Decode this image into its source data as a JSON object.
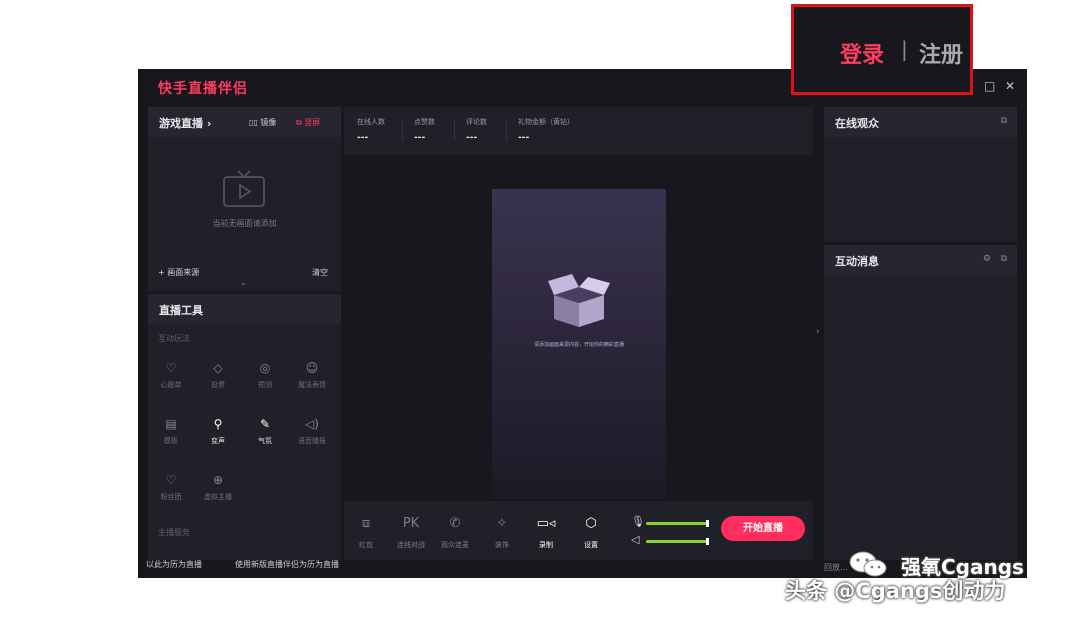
{
  "app": {
    "title": "快手直播伴侣",
    "window_controls": {
      "maximize": "□",
      "close": "✕"
    }
  },
  "auth": {
    "login": "登录",
    "separator": "|",
    "register": "注册"
  },
  "scene_panel": {
    "title": "游戏直播 ›",
    "mirror": "镜像",
    "portrait": "竖屏",
    "empty_hint": "当前无画面请添加",
    "add_source": "+ 画面来源",
    "clear": "清空"
  },
  "tools_panel": {
    "title": "直播工具",
    "section_interactive": "互动玩法",
    "tools": [
      {
        "icon": "wish-list-icon",
        "glyph": "♡",
        "label": "心愿单",
        "active": false
      },
      {
        "icon": "vote-icon",
        "glyph": "◇",
        "label": "投票",
        "active": false
      },
      {
        "icon": "predict-icon",
        "glyph": "◎",
        "label": "预测",
        "active": false
      },
      {
        "icon": "magic-face-icon",
        "glyph": "☺",
        "label": "魔法表情",
        "active": false
      },
      {
        "icon": "template-icon",
        "glyph": "▤",
        "label": "模板",
        "active": false
      },
      {
        "icon": "voice-change-icon",
        "glyph": "⚲",
        "label": "变声",
        "active": true
      },
      {
        "icon": "atmosphere-icon",
        "glyph": "✎",
        "label": "气氛",
        "active": true
      },
      {
        "icon": "voice-broadcast-icon",
        "glyph": "◁)",
        "label": "语音播报",
        "active": false
      },
      {
        "icon": "fan-group-icon",
        "glyph": "♡",
        "label": "粉丝团",
        "active": false
      },
      {
        "icon": "virtual-host-icon",
        "glyph": "⊕",
        "label": "虚拟主播",
        "active": false
      }
    ],
    "section_host": "主播服务",
    "footer_left": "以此为历为直播",
    "footer_right": "使用新版直播伴侣为历为直播"
  },
  "stats": [
    {
      "label": "在线人数",
      "value": "---"
    },
    {
      "label": "点赞数",
      "value": "---"
    },
    {
      "label": "评论数",
      "value": "---"
    },
    {
      "label": "礼物金额（黄钻）",
      "value": "---"
    }
  ],
  "preview": {
    "hint": "请添加画面来源内容，开始你的精彩直播"
  },
  "bottom_tools": [
    {
      "icon": "red-packet-icon",
      "glyph": "⧈",
      "label": "红包",
      "active": false
    },
    {
      "icon": "pk-icon",
      "glyph": "PK",
      "label": "连线对战",
      "active": false
    },
    {
      "icon": "audience-call-icon",
      "glyph": "✆",
      "label": "观众连麦",
      "active": false
    },
    {
      "icon": "decoration-icon",
      "glyph": "✧",
      "label": "装饰",
      "active": false
    },
    {
      "icon": "record-icon",
      "glyph": "▭◃",
      "label": "录制",
      "active": true
    },
    {
      "icon": "settings-icon",
      "glyph": "⬡",
      "label": "设置",
      "active": true
    }
  ],
  "audio": {
    "mic_level": 0.95,
    "speaker_level": 0.95
  },
  "start_button": "开始直播",
  "right_panel": {
    "audience_title": "在线观众",
    "messages_title": "互动消息",
    "footer": "回放..."
  },
  "watermarks": {
    "wechat": "强氧Cgangs",
    "toutiao": "头条 @Cgangs创动力"
  },
  "colors": {
    "accent": "#ff2e5f",
    "panel": "#202029",
    "background": "#17171d",
    "level": "#8bd132"
  }
}
